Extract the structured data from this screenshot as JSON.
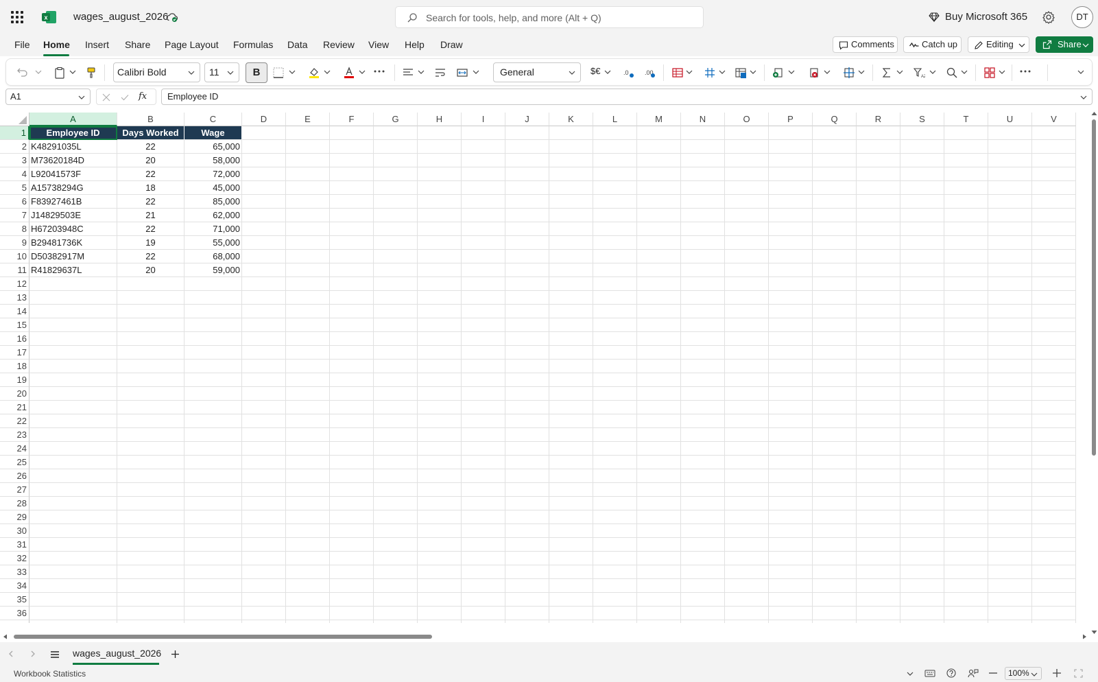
{
  "app": {
    "doc_title": "wages_august_2026",
    "search_placeholder": "Search for tools, help, and more (Alt + Q)",
    "buy_label": "Buy Microsoft 365",
    "avatar_initials": "DT"
  },
  "menu": {
    "tabs": [
      "File",
      "Home",
      "Insert",
      "Share",
      "Page Layout",
      "Formulas",
      "Data",
      "Review",
      "View",
      "Help",
      "Draw"
    ],
    "comments_label": "Comments",
    "catchup_label": "Catch up",
    "editing_label": "Editing",
    "share_label": "Share"
  },
  "ribbon": {
    "font_name": "Calibri Bold",
    "font_size": "11",
    "bold_label": "B",
    "number_format": "General",
    "currency_label": "$€"
  },
  "formula_bar": {
    "name_box": "A1",
    "fx_label": "fx",
    "content": "Employee ID"
  },
  "grid": {
    "columns": [
      "A",
      "B",
      "C",
      "D",
      "E",
      "F",
      "G",
      "H",
      "I",
      "J",
      "K",
      "L",
      "M",
      "N",
      "O",
      "P",
      "Q",
      "R",
      "S",
      "T",
      "U",
      "V"
    ],
    "row_count": 37,
    "header": [
      "Employee ID",
      "Days Worked",
      "Wage"
    ],
    "rows": [
      [
        "K48291035L",
        "22",
        "65,000"
      ],
      [
        "M73620184D",
        "20",
        "58,000"
      ],
      [
        "L92041573F",
        "22",
        "72,000"
      ],
      [
        "A15738294G",
        "18",
        "45,000"
      ],
      [
        "F83927461B",
        "22",
        "85,000"
      ],
      [
        "J14829503E",
        "21",
        "62,000"
      ],
      [
        "H67203948C",
        "22",
        "71,000"
      ],
      [
        "B29481736K",
        "19",
        "55,000"
      ],
      [
        "D50382917M",
        "22",
        "68,000"
      ],
      [
        "R41829637L",
        "20",
        "59,000"
      ]
    ]
  },
  "sheets": {
    "active": "wages_august_2026"
  },
  "status": {
    "left_text": "Workbook Statistics",
    "zoom": "100%"
  },
  "colors": {
    "accent": "#107c41",
    "header_fill": "#1f3a52"
  }
}
